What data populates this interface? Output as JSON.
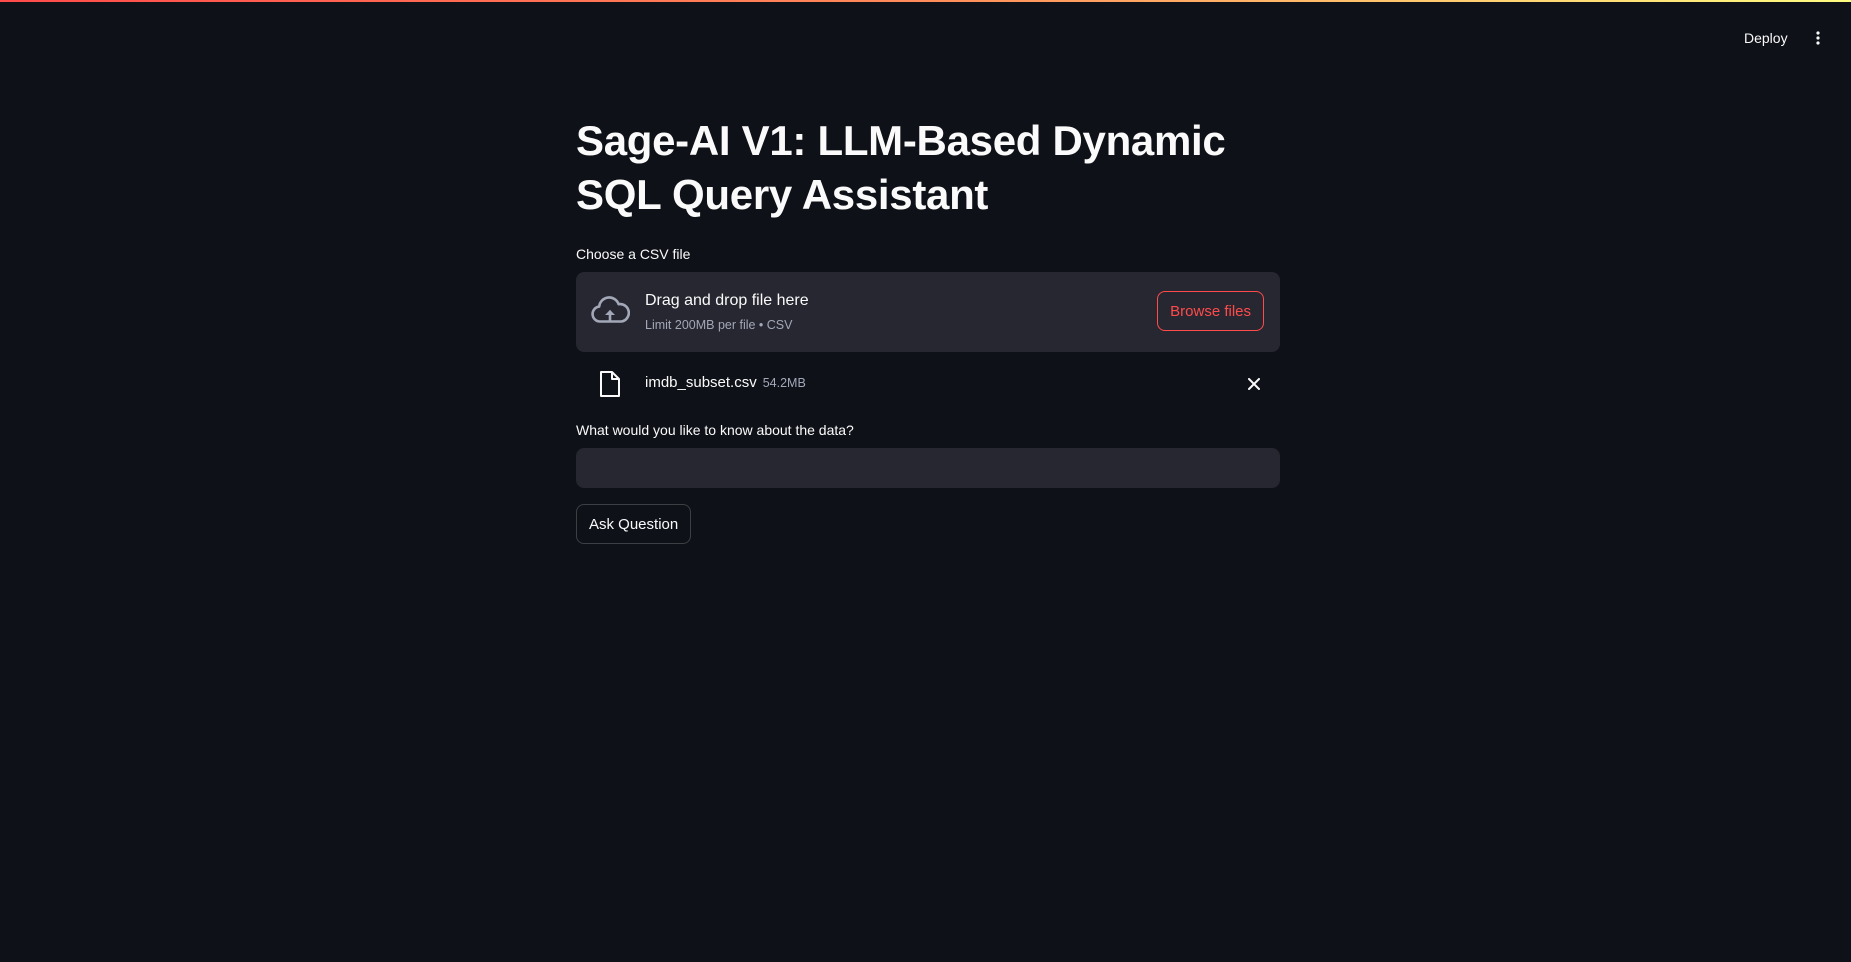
{
  "header": {
    "deploy_label": "Deploy",
    "menu_icon": "vertical-dots-icon"
  },
  "main": {
    "title": "Sage-AI V1: LLM-Based Dynamic SQL Query Assistant",
    "uploader": {
      "label": "Choose a CSV file",
      "drop_text": "Drag and drop file here",
      "limit_text": "Limit 200MB per file • CSV",
      "browse_label": "Browse files",
      "icon": "cloud-upload-icon"
    },
    "uploaded_file": {
      "name": "imdb_subset.csv",
      "size": "54.2MB",
      "icon": "file-icon",
      "remove_icon": "close-icon"
    },
    "question": {
      "label": "What would you like to know about the data?",
      "value": "",
      "placeholder": ""
    },
    "ask_label": "Ask Question"
  },
  "colors": {
    "background": "#0e1117",
    "surface": "#262730",
    "accent": "#ff4b4b",
    "text": "#fafafa",
    "muted": "#a3a8b8"
  }
}
